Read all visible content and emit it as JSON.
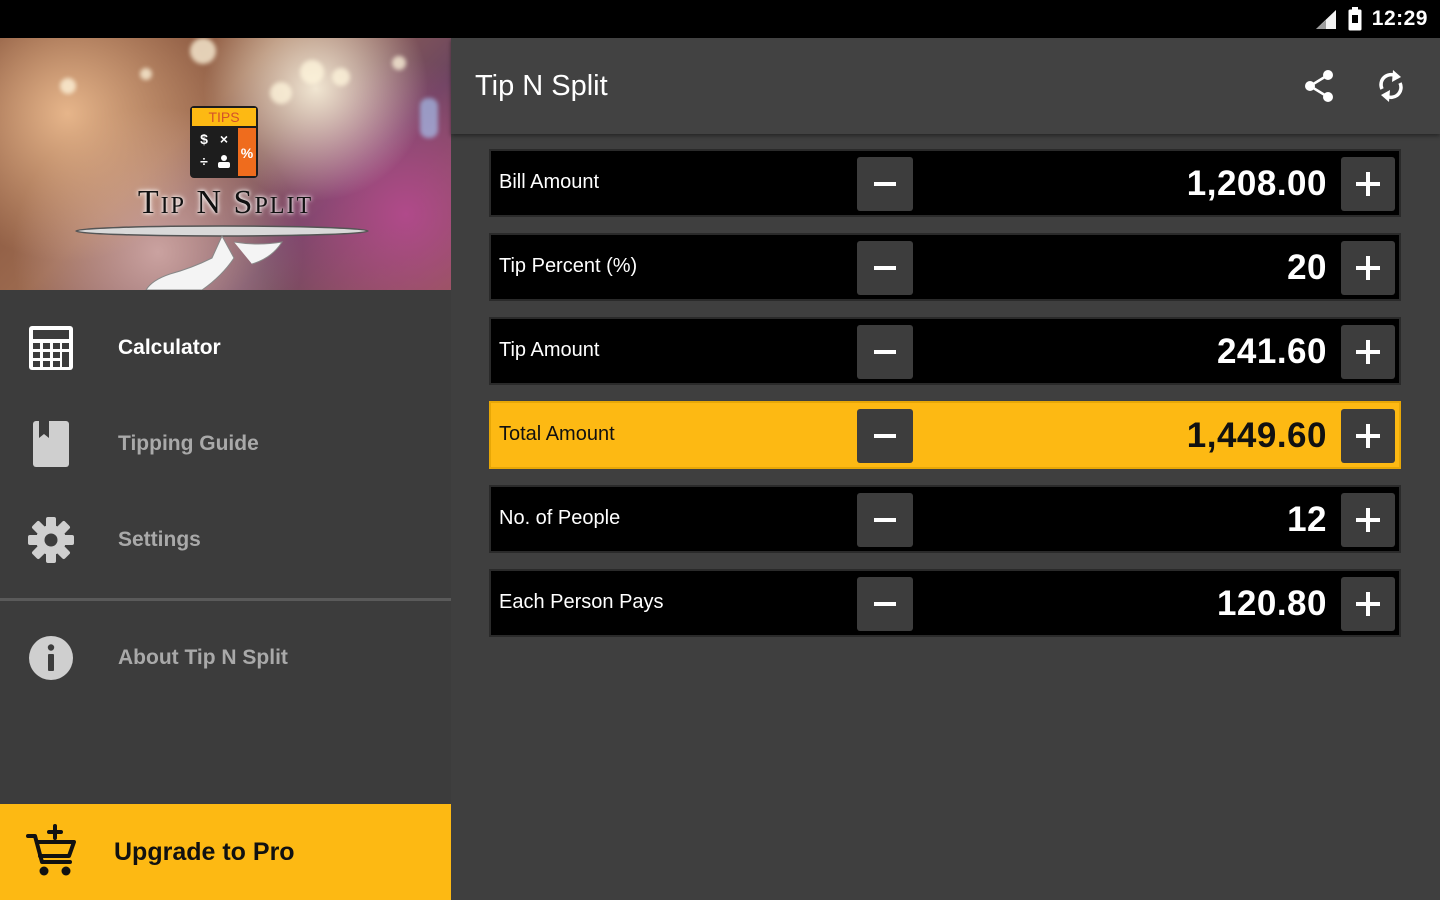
{
  "status_bar": {
    "time": "12:29"
  },
  "drawer": {
    "header": {
      "brand": "Tip N Split",
      "logo_text": "TIPS"
    },
    "items": [
      {
        "label": "Calculator",
        "icon": "calculator-icon",
        "active": true
      },
      {
        "label": "Tipping Guide",
        "icon": "book-icon",
        "active": false
      },
      {
        "label": "Settings",
        "icon": "gear-icon",
        "active": false
      },
      {
        "label": "About Tip N Split",
        "icon": "info-icon",
        "active": false
      }
    ],
    "upgrade": {
      "label": "Upgrade to Pro",
      "icon": "add-cart-icon"
    }
  },
  "appbar": {
    "title": "Tip N Split",
    "actions": [
      "share-icon",
      "refresh-icon"
    ]
  },
  "rows": [
    {
      "label": "Bill Amount",
      "value": "1,208.00"
    },
    {
      "label": "Tip Percent (%)",
      "value": "20"
    },
    {
      "label": "Tip Amount",
      "value": "241.60"
    },
    {
      "label": "Total Amount",
      "value": "1,449.60",
      "highlight": true
    },
    {
      "label": "No. of People",
      "value": "12"
    },
    {
      "label": "Each Person Pays",
      "value": "120.80"
    }
  ],
  "colors": {
    "accent": "#fdb913",
    "background": "#3f3f3f",
    "row": "#000000"
  }
}
